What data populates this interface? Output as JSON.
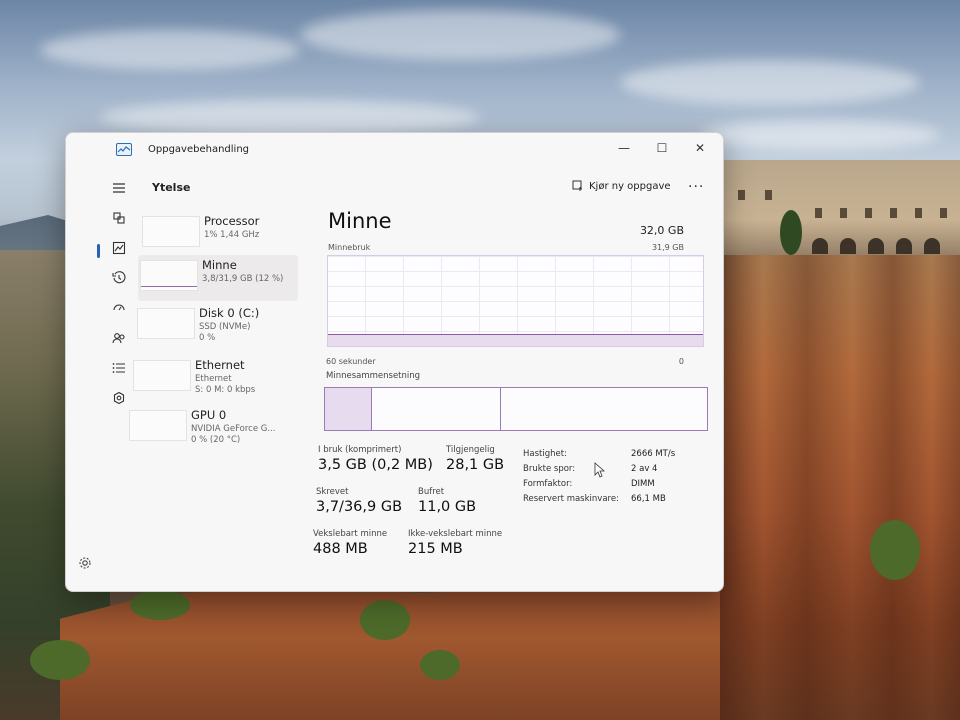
{
  "window": {
    "title": "Oppgavebehandling",
    "controls": {
      "minimize": "—",
      "maximize": "☐",
      "close": "✕"
    }
  },
  "header": {
    "section_title": "Ytelse",
    "run_task_label": "Kjør ny oppgave",
    "more_label": "..."
  },
  "nav": {
    "items": [
      "menu-icon",
      "processes-icon",
      "performance-icon",
      "app-history-icon",
      "startup-apps-icon",
      "users-icon",
      "details-icon",
      "services-icon"
    ],
    "active": "performance-icon",
    "settings": "settings-icon"
  },
  "perf_list": [
    {
      "name": "Processor",
      "sub1": "1% 1,44 GHz",
      "sub2": ""
    },
    {
      "name": "Minne",
      "sub1": "3,8/31,9 GB (12 %)",
      "sub2": ""
    },
    {
      "name": "Disk 0 (C:)",
      "sub1": "SSD (NVMe)",
      "sub2": "0 %"
    },
    {
      "name": "Ethernet",
      "sub1": "Ethernet",
      "sub2": "S: 0 M: 0 kbps"
    },
    {
      "name": "GPU 0",
      "sub1": "NVIDIA GeForce G...",
      "sub2": "0 % (20 °C)"
    }
  ],
  "memory": {
    "title": "Minne",
    "total": "32,0 GB",
    "usage_label": "Minnebruk",
    "usage_max": "31,9 GB",
    "usage_fraction": 0.12,
    "graph_time_left": "60 sekunder",
    "graph_time_right": "0",
    "composition_label": "Minnesammensetning",
    "stats": {
      "in_use_label": "I bruk (komprimert)",
      "in_use_value": "3,5 GB (0,2 MB)",
      "available_label": "Tilgjengelig",
      "available_value": "28,1 GB",
      "committed_label": "Skrevet",
      "committed_value": "3,7/36,9 GB",
      "cached_label": "Bufret",
      "cached_value": "11,0 GB",
      "paged_label": "Vekslebart minne",
      "paged_value": "488 MB",
      "nonpaged_label": "Ikke-vekslebart minne",
      "nonpaged_value": "215 MB"
    },
    "properties": [
      {
        "key": "Hastighet:",
        "value": "2666 MT/s"
      },
      {
        "key": "Brukte spor:",
        "value": "2 av 4"
      },
      {
        "key": "Formfaktor:",
        "value": "DIMM"
      },
      {
        "key": "Reservert maskinvare:",
        "value": "66,1 MB"
      }
    ]
  }
}
